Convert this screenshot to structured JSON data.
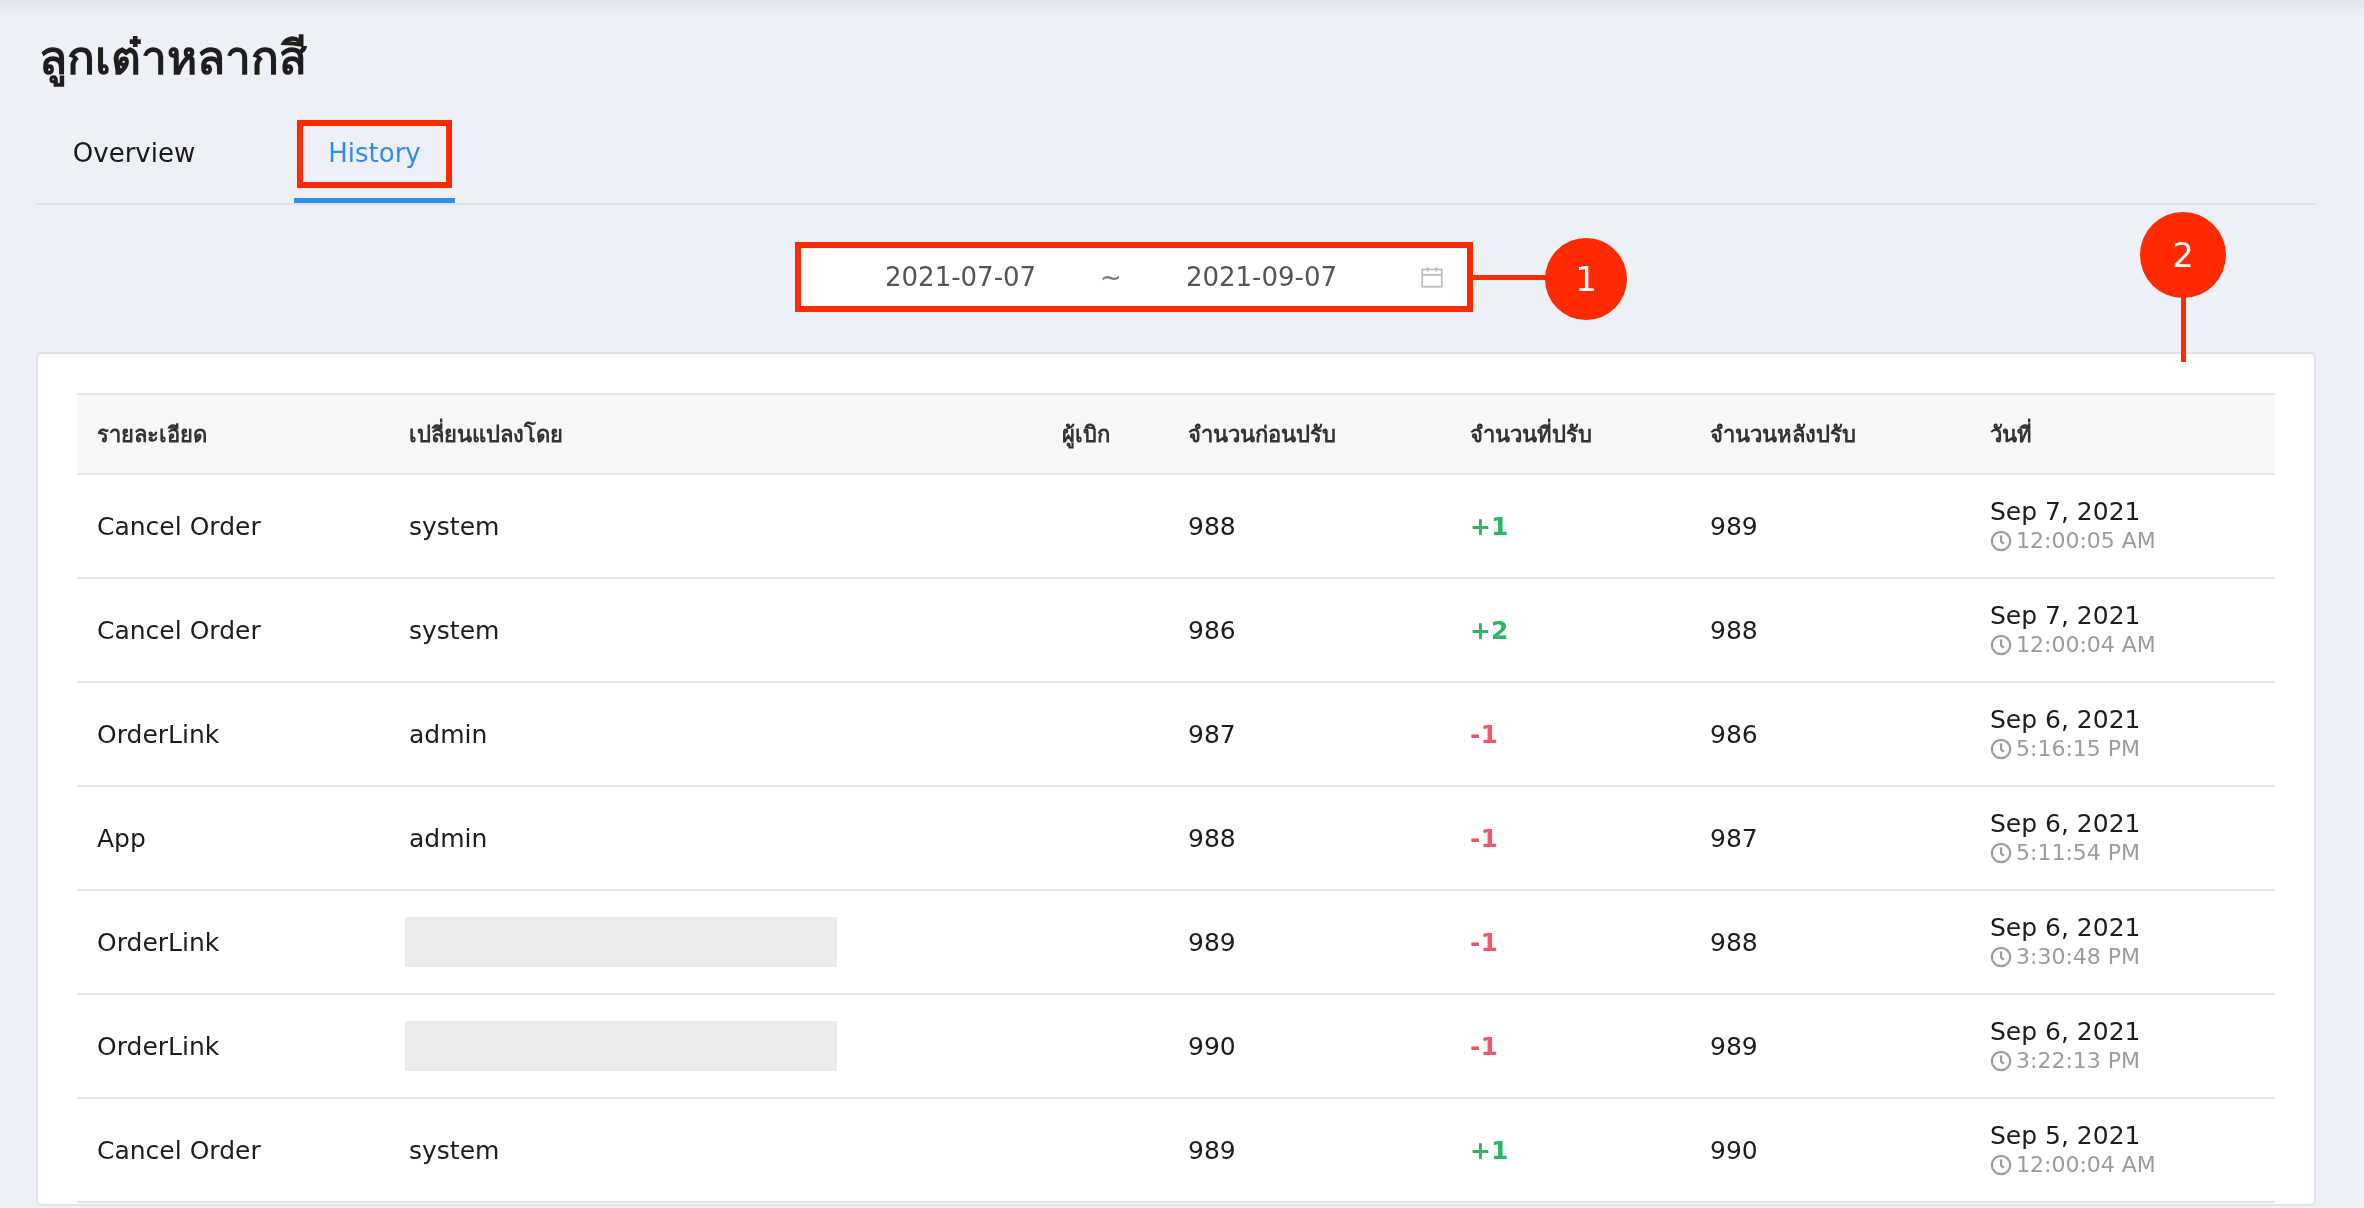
{
  "title": "ลูกเต๋าหลากสี",
  "tabs": [
    {
      "label": "Overview",
      "selected": false,
      "highlighted": false
    },
    {
      "label": "History",
      "selected": true,
      "highlighted": true
    }
  ],
  "date_range": {
    "start": "2021-07-07",
    "separator": "~",
    "end": "2021-09-07",
    "highlighted": true
  },
  "callouts": [
    {
      "label": "1"
    },
    {
      "label": "2"
    }
  ],
  "table": {
    "columns": [
      "รายละเอียด",
      "เปลี่ยนแปลงโดย",
      "ผู้เบิก",
      "จำนวนก่อนปรับ",
      "จำนวนที่ปรับ",
      "จำนวนหลังปรับ",
      "วันที่"
    ],
    "rows": [
      {
        "detail": "Cancel Order",
        "changed_by": "system",
        "redacted": false,
        "before": "988",
        "change": "+1",
        "increase": true,
        "after": "989",
        "date": "Sep 7, 2021",
        "time": "12:00:05 AM"
      },
      {
        "detail": "Cancel Order",
        "changed_by": "system",
        "redacted": false,
        "before": "986",
        "change": "+2",
        "increase": true,
        "after": "988",
        "date": "Sep 7, 2021",
        "time": "12:00:04 AM"
      },
      {
        "detail": "OrderLink",
        "changed_by": "admin",
        "redacted": false,
        "before": "987",
        "change": "-1",
        "increase": false,
        "after": "986",
        "date": "Sep 6, 2021",
        "time": "5:16:15 PM"
      },
      {
        "detail": "App",
        "changed_by": "admin",
        "redacted": false,
        "before": "988",
        "change": "-1",
        "increase": false,
        "after": "987",
        "date": "Sep 6, 2021",
        "time": "5:11:54 PM"
      },
      {
        "detail": "OrderLink",
        "redacted": true,
        "before": "989",
        "change": "-1",
        "increase": false,
        "after": "988",
        "date": "Sep 6, 2021",
        "time": "3:30:48 PM"
      },
      {
        "detail": "OrderLink",
        "redacted": true,
        "before": "990",
        "change": "-1",
        "increase": false,
        "after": "989",
        "date": "Sep 6, 2021",
        "time": "3:22:13 PM"
      },
      {
        "detail": "Cancel Order",
        "changed_by": "system",
        "redacted": false,
        "before": "989",
        "change": "+1",
        "increase": true,
        "after": "990",
        "date": "Sep 5, 2021",
        "time": "12:00:04 AM"
      }
    ]
  }
}
